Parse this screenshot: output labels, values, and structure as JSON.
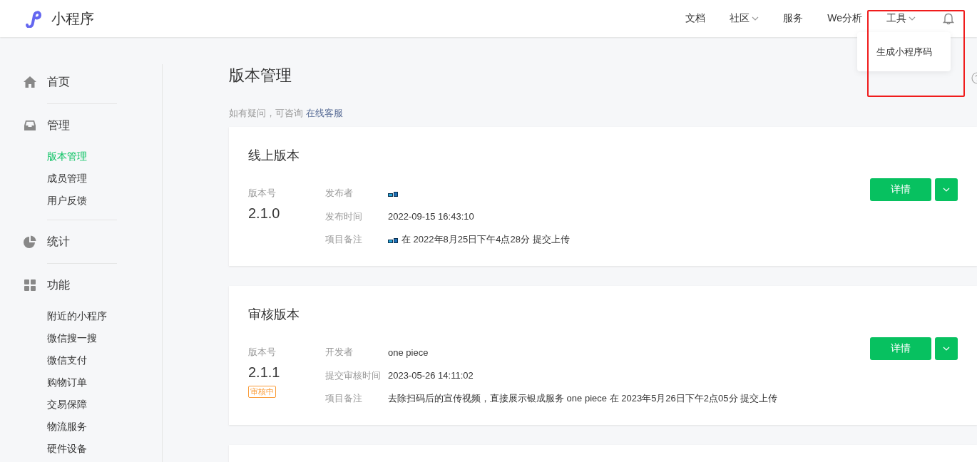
{
  "header": {
    "logo": "小程序",
    "nav": [
      {
        "label": "文档",
        "dropdown": false
      },
      {
        "label": "社区",
        "dropdown": true
      },
      {
        "label": "服务",
        "dropdown": false
      },
      {
        "label": "We分析",
        "dropdown": false
      },
      {
        "label": "工具",
        "dropdown": true
      }
    ],
    "dropdown_menu": {
      "items": [
        "生成小程序码"
      ]
    }
  },
  "sidebar": {
    "sections": [
      {
        "label": "首页",
        "kind": "home"
      },
      {
        "label": "管理",
        "kind": "inbox",
        "items": [
          {
            "label": "版本管理",
            "selected": true
          },
          {
            "label": "成员管理",
            "selected": false
          },
          {
            "label": "用户反馈",
            "selected": false
          }
        ]
      },
      {
        "label": "统计",
        "kind": "pie"
      },
      {
        "label": "功能",
        "kind": "grid",
        "items": [
          {
            "label": "附近的小程序",
            "selected": false
          },
          {
            "label": "微信搜一搜",
            "selected": false
          },
          {
            "label": "微信支付",
            "selected": false
          },
          {
            "label": "购物订单",
            "selected": false
          },
          {
            "label": "交易保障",
            "selected": false
          },
          {
            "label": "物流服务",
            "selected": false
          },
          {
            "label": "硬件设备",
            "selected": false
          }
        ]
      }
    ]
  },
  "page": {
    "title": "版本管理",
    "help_text": "如有疑问，可咨询",
    "help_link": "在线客服",
    "cards": [
      {
        "title": "线上版本",
        "version_label": "版本号",
        "version": "2.1.0",
        "detail_button": "详情",
        "fields": [
          {
            "label": "发布者",
            "avatar": true
          },
          {
            "label": "发布时间",
            "avatar": false,
            "value": "2022-09-15 16:43:10"
          },
          {
            "label": "项目备注",
            "avatar": true,
            "value": "在 2022年8月25日下午4点28分 提交上传"
          }
        ]
      },
      {
        "title": "审核版本",
        "version_label": "版本号",
        "version": "2.1.1",
        "badge": "审核中",
        "detail_button": "详情",
        "fields": [
          {
            "label": "开发者",
            "avatar": false,
            "value": "one piece"
          },
          {
            "label": "提交审核时间",
            "avatar": false,
            "value": "2023-05-26 14:11:02"
          },
          {
            "label": "项目备注",
            "avatar": false,
            "value": "去除扫码后的宣传视频，直接展示银成服务 one piece 在 2023年5月26日下午2点05分 提交上传"
          }
        ]
      }
    ]
  }
}
